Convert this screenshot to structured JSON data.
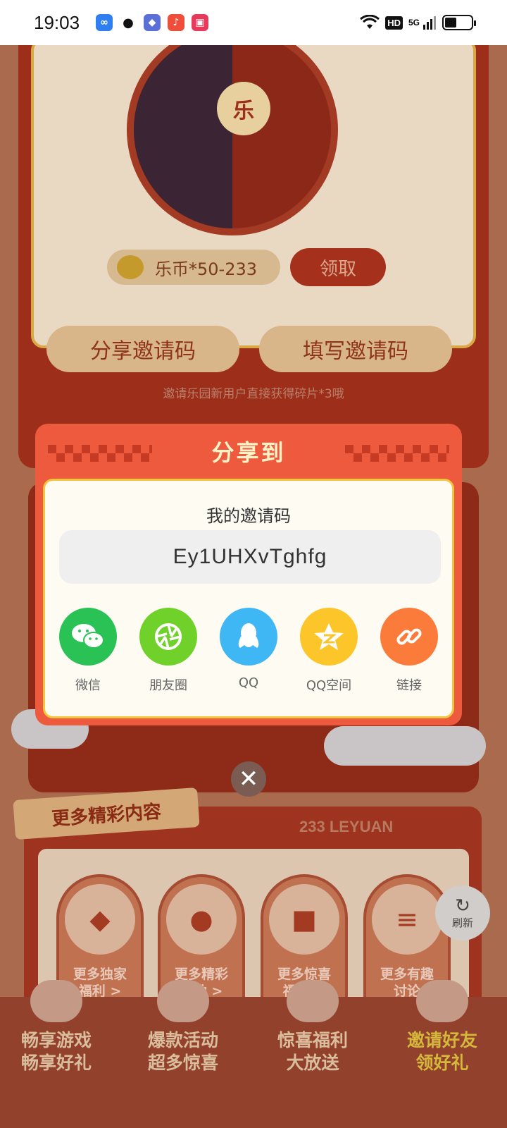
{
  "status_bar": {
    "time": "19:03",
    "hd": "HD",
    "network": "5G"
  },
  "background": {
    "wheel_center": "乐",
    "reward_text": "乐币*50-233",
    "claim_label": "领取",
    "share_code_btn": "分享邀请码",
    "fill_code_btn": "填写邀请码",
    "invite_hint": "邀请乐园新用户直接获得碎片*3哦",
    "more_title": "更多精彩内容",
    "leyuan_label": "233 LEYUAN",
    "features": [
      {
        "label_1": "更多独家",
        "label_2": "福利 >"
      },
      {
        "label_1": "更多精彩",
        "label_2": "活动 >"
      },
      {
        "label_1": "更多惊喜",
        "label_2": "福利 >"
      },
      {
        "label_1": "更多有趣",
        "label_2": "讨论"
      }
    ],
    "refresh_label": "刷新",
    "bottom_nav": [
      {
        "line1": "畅享游戏",
        "line2": "畅享好礼"
      },
      {
        "line1": "爆款活动",
        "line2": "超多惊喜"
      },
      {
        "line1": "惊喜福利",
        "line2": "大放送"
      },
      {
        "line1": "邀请好友",
        "line2": "领好礼"
      }
    ]
  },
  "modal": {
    "title": "分享到",
    "code_label": "我的邀请码",
    "invite_code": "Ey1UHXvTghfg",
    "share_targets": [
      {
        "label": "微信",
        "icon": "wechat-icon",
        "color": "#2bc255"
      },
      {
        "label": "朋友圈",
        "icon": "moments-icon",
        "color": "#71d12b"
      },
      {
        "label": "QQ",
        "icon": "qq-icon",
        "color": "#3fb7f5"
      },
      {
        "label": "QQ空间",
        "icon": "qzone-icon",
        "color": "#fcc52a"
      },
      {
        "label": "链接",
        "icon": "link-icon",
        "color": "#fb7b3a"
      }
    ],
    "close_glyph": "✕"
  },
  "colors": {
    "modal_bg": "#ed5a3e",
    "modal_border": "#f5c53d",
    "title_text": "#fff4c8"
  }
}
